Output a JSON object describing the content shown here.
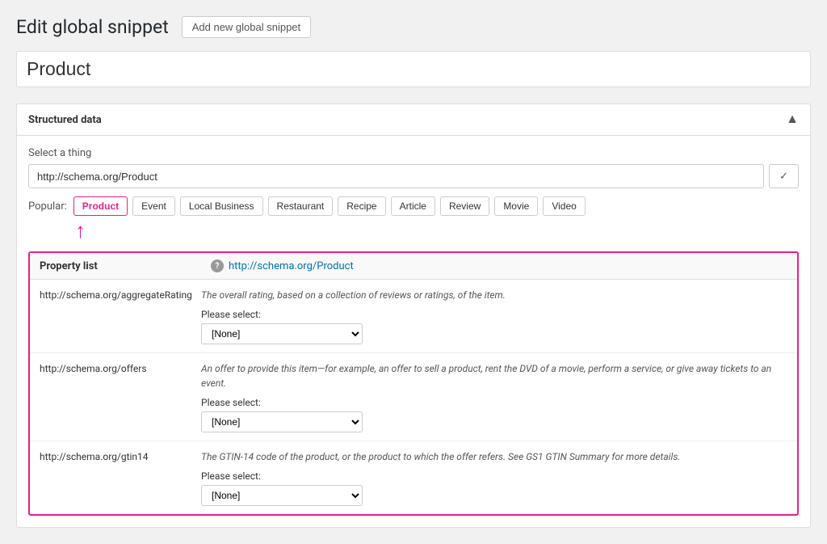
{
  "header": {
    "title": "Edit global snippet",
    "add_new_label": "Add new global snippet"
  },
  "snippet_name": "Product",
  "structured_data": {
    "section_title": "Structured data",
    "select_thing_label": "Select a thing",
    "schema_url_value": "http://schema.org/Product",
    "check_button_label": "✓",
    "popular_label": "Popular:",
    "popular_buttons": [
      {
        "id": "product",
        "label": "Product",
        "active": true
      },
      {
        "id": "event",
        "label": "Event",
        "active": false
      },
      {
        "id": "local-business",
        "label": "Local Business",
        "active": false
      },
      {
        "id": "restaurant",
        "label": "Restaurant",
        "active": false
      },
      {
        "id": "recipe",
        "label": "Recipe",
        "active": false
      },
      {
        "id": "article",
        "label": "Article",
        "active": false
      },
      {
        "id": "review",
        "label": "Review",
        "active": false
      },
      {
        "id": "movie",
        "label": "Movie",
        "active": false
      },
      {
        "id": "video",
        "label": "Video",
        "active": false
      }
    ],
    "property_list_label": "Property list",
    "property_schema_link": "http://schema.org/Product",
    "properties": [
      {
        "name": "http://schema.org/aggregateRating",
        "description": "The overall rating, based on a collection of reviews or ratings, of the item.",
        "select_label": "Please select:",
        "select_value": "[None]"
      },
      {
        "name": "http://schema.org/offers",
        "description": "An offer to provide this item—for example, an offer to sell a product, rent the DVD of a movie, perform a service, or give away tickets to an event.",
        "select_label": "Please select:",
        "select_value": "[None]"
      },
      {
        "name": "http://schema.org/gtin14",
        "description": "The GTIN-14 code of the product, or the product to which the offer refers. See GS1 GTIN Summary for more details.",
        "select_label": "Please select:",
        "select_value": "[None]"
      }
    ]
  }
}
